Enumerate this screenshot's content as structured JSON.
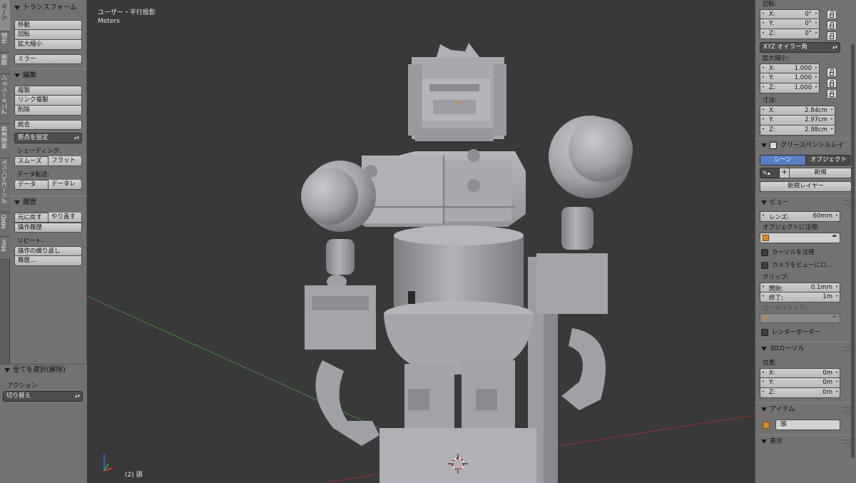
{
  "vtabs": [
    "ツール",
    "作成",
    "関係",
    "アニメーション",
    "物理演算",
    "グリースペンシル",
    "MMD",
    "Misc"
  ],
  "left": {
    "transform": {
      "title": "トランスフォーム",
      "buttons": [
        "移動",
        "回転",
        "拡大縮小"
      ],
      "mirror": "ミラー"
    },
    "edit": {
      "title": "編集",
      "buttons": [
        "複製",
        "リンク複製",
        "削除"
      ],
      "join": "統合",
      "origin": "原点を設定"
    },
    "shading": {
      "label": "シェーディング:",
      "smooth": "スムーズ",
      "flat": "フラット"
    },
    "datatransfer": {
      "label": "データ転送:",
      "data": "データ",
      "datal": "データレ"
    },
    "history": {
      "title": "履歴",
      "undo": "元に戻す",
      "redo": "やり直す",
      "ophistory": "操作履歴",
      "repeat_label": "リピート:",
      "repeat_last": "操作の繰り返し",
      "repeat_history": "履歴..."
    },
    "selectall": {
      "title": "全てを選択(解除)",
      "action_label": "アクション",
      "action_value": "切り替え"
    }
  },
  "viewport": {
    "view_name": "ユーザー・平行投影",
    "units": "Meters",
    "object_info": "(2) 頭",
    "colors": {
      "background": "#393939",
      "x_axis": "#9b3030",
      "y_axis": "#3e8a3e",
      "model": "#a2a2a8"
    }
  },
  "right": {
    "rotation": {
      "label": "回転:",
      "x": "0°",
      "y": "0°",
      "z": "0°",
      "mode": "XYZ オイラー角"
    },
    "scale": {
      "label": "拡大縮小:",
      "x": "1.000",
      "y": "1.000",
      "z": "1.000"
    },
    "dimensions": {
      "label": "寸法:",
      "x": "2.84cm",
      "y": "2.97cm",
      "z": "2.98cm"
    },
    "grease": {
      "title": "グリースペンシルレイ",
      "scene": "シーン",
      "object": "オブジェクト",
      "new": "新規",
      "new_layer": "新規レイヤー"
    },
    "view": {
      "title": "ビュー",
      "lens_label": "レンズ:",
      "lens_value": "60mm",
      "lock_object": "オブジェクトに注視:",
      "lock_cursor": "カーソルを注視",
      "lock_camera": "カメラをビューにロ...",
      "clip_label": "クリップ:",
      "clip_start_label": "開始:",
      "clip_start": "0.1mm",
      "clip_end_label": "終了:",
      "clip_end": "1m",
      "local_camera": "ローカルカメラ:",
      "render_border": "レンダーボーダー"
    },
    "cursor": {
      "title": "3Dカーソル",
      "location": "位置:",
      "x": "0m",
      "y": "0m",
      "z": "0m"
    },
    "item": {
      "title": "アイテム",
      "name": "頭"
    },
    "display": {
      "title": "表示"
    }
  },
  "labels": {
    "x": "X:",
    "y": "Y:",
    "z": "Z:"
  }
}
